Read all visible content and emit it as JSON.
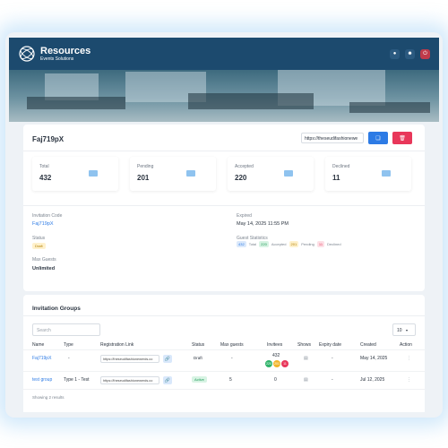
{
  "brand": {
    "title": "Resources",
    "subtitle": "Events Solutions"
  },
  "topbar": {
    "icons": [
      "bell-icon",
      "user-icon",
      "power-icon"
    ]
  },
  "invitation": {
    "code_title": "Faj719pX",
    "url_value": "https://theseudifashionewe",
    "copy_icon": "copy-icon",
    "delete_icon": "trash-icon"
  },
  "stats": [
    {
      "label": "Total",
      "value": "432"
    },
    {
      "label": "Pending",
      "value": "201"
    },
    {
      "label": "Accepted",
      "value": "220"
    },
    {
      "label": "Declined",
      "value": "11"
    }
  ],
  "details": {
    "code_label": "Invitation Code",
    "code_value": "Faj719pX",
    "expired_label": "Expired",
    "expired_value": "May 14, 2025 11:55 PM",
    "status_label": "Status",
    "status_value": "Draft",
    "stats_label": "Guest Statistics",
    "guest_stats": [
      {
        "num": "432",
        "label": "Total"
      },
      {
        "num": "220",
        "label": "Accepted"
      },
      {
        "num": "201",
        "label": "Pending"
      },
      {
        "num": "11",
        "label": "Declined"
      }
    ],
    "max_label": "Max Guests",
    "max_value": "Unlimited"
  },
  "groups": {
    "title": "Invitation Groups",
    "search_placeholder": "Search",
    "per_page": "10",
    "columns": [
      "Name",
      "Type",
      "Registration Link",
      "Status",
      "Max guests",
      "Invitees",
      "Shows",
      "Expiry date",
      "Created",
      "Action"
    ],
    "rows": [
      {
        "name": "Faj719pX",
        "type": "-",
        "link": "https://theseudifashionewerds.co",
        "status": "Draft",
        "max": "-",
        "invitees": "432",
        "dots": [
          "220",
          "201",
          "11"
        ],
        "expiry": "-",
        "created": "May 14, 2025"
      },
      {
        "name": "test group",
        "type": "Type 1 - Test",
        "link": "https://theseudifashionewerds.co",
        "status": "Active",
        "max": "5",
        "invitees": "0",
        "dots": [],
        "expiry": "-",
        "created": "Jul 12, 2025"
      }
    ],
    "showing": "Showing 2 results"
  },
  "colors": {
    "primary": "#1c4a6e",
    "accent": "#2d7be5",
    "danger": "#e8375a"
  }
}
